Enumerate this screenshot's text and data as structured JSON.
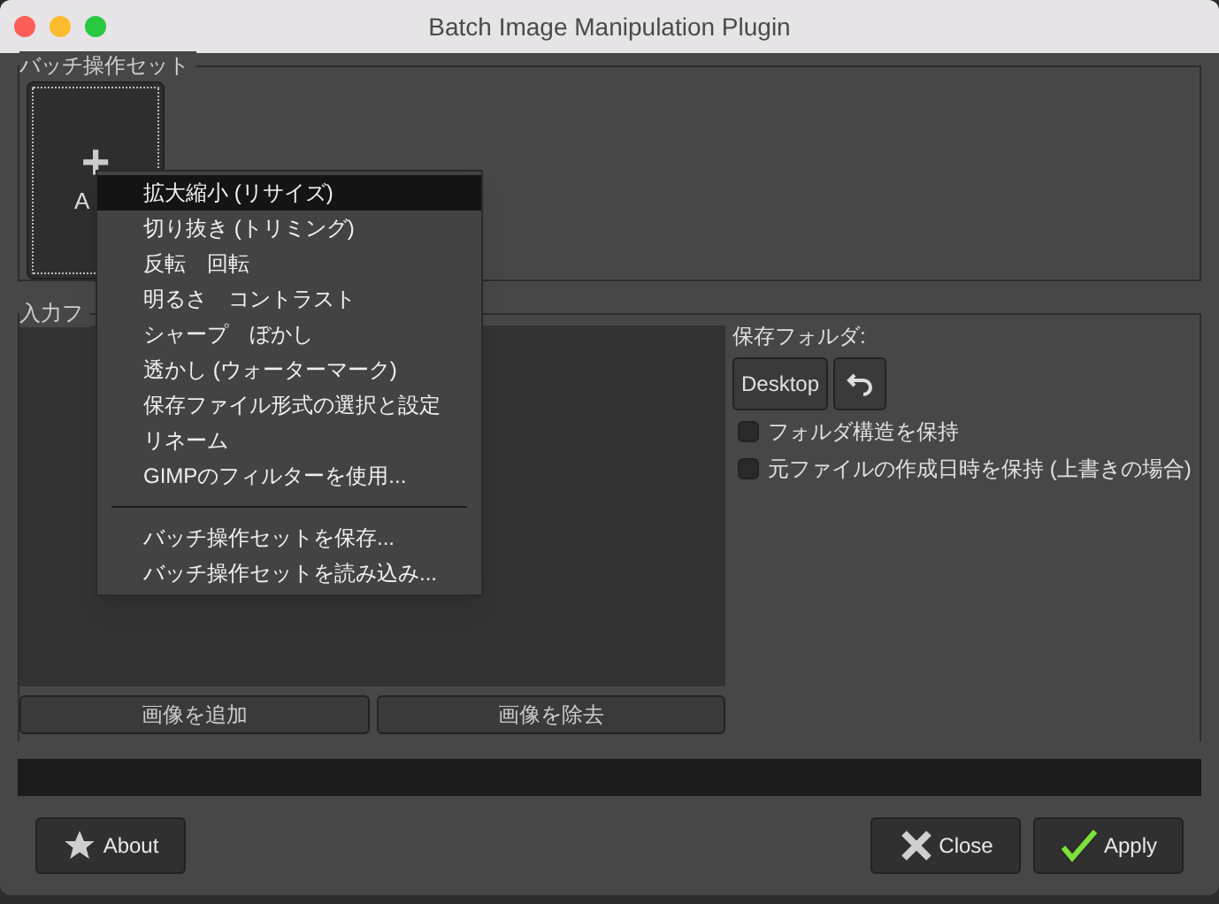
{
  "window": {
    "title": "Batch Image Manipulation Plugin"
  },
  "manipulation_set": {
    "legend": "バッチ操作セット",
    "add_button": {
      "icon": "+",
      "label": "A"
    }
  },
  "input_files": {
    "legend": "入力フ",
    "buttons": [
      "画像を追加",
      "画像を除去"
    ]
  },
  "output": {
    "label": "保存フォルダ:",
    "folder_button": "Desktop",
    "options": [
      {
        "label": "フォルダ構造を保持",
        "checked": false
      },
      {
        "label": "元ファイルの作成日時を保持 (上書きの場合)",
        "checked": false
      }
    ]
  },
  "progress": {
    "level": 0
  },
  "buttons": [
    {
      "kind": "about",
      "label": "About"
    },
    {
      "kind": "close",
      "label": "Close"
    },
    {
      "kind": "apply",
      "label": "Apply"
    }
  ],
  "context_menu": {
    "items": [
      {
        "kind": "item",
        "label": "拡大縮小 (リサイズ)",
        "selected": true
      },
      {
        "kind": "item",
        "label": "切り抜き (トリミング)",
        "selected": false
      },
      {
        "kind": "item",
        "label": "反転　回転",
        "selected": false
      },
      {
        "kind": "item",
        "label": "明るさ　コントラスト",
        "selected": false
      },
      {
        "kind": "item",
        "label": "シャープ　ぼかし",
        "selected": false
      },
      {
        "kind": "item",
        "label": "透かし (ウォーターマーク)",
        "selected": false
      },
      {
        "kind": "item",
        "label": "保存ファイル形式の選択と設定",
        "selected": false
      },
      {
        "kind": "item",
        "label": "リネーム",
        "selected": false
      },
      {
        "kind": "item",
        "label": "GIMPのフィルターを使用...",
        "selected": false
      },
      {
        "kind": "separator"
      },
      {
        "kind": "item",
        "label": "バッチ操作セットを保存...",
        "selected": false
      },
      {
        "kind": "item",
        "label": "バッチ操作セットを読み込み...",
        "selected": false
      }
    ]
  }
}
